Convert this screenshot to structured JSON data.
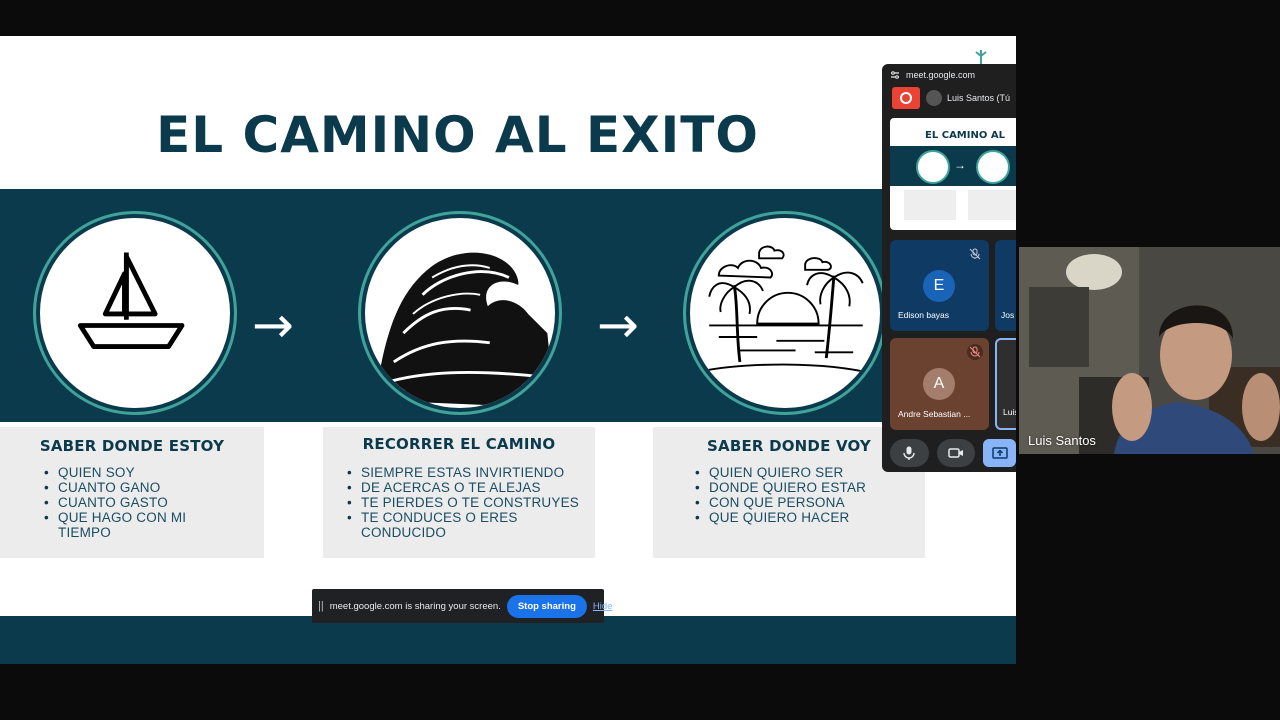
{
  "slide": {
    "title": "EL CAMINO AL EXITO",
    "arrows": [
      "→",
      "→"
    ],
    "cards": [
      {
        "heading": "SABER DONDE ESTOY",
        "items": [
          "QUIEN SOY",
          "CUANTO GANO",
          "CUANTO GASTO",
          "QUE HAGO CON MI TIEMPO"
        ]
      },
      {
        "heading": "RECORRER EL CAMINO",
        "items": [
          "SIEMPRE ESTAS INVIRTIENDO",
          "DE ACERCAS O TE ALEJAS",
          "TE PIERDES O TE CONSTRUYES",
          "TE CONDUCES O ERES CONDUCIDO"
        ]
      },
      {
        "heading": "SABER DONDE VOY",
        "items": [
          "QUIEN QUIERO SER",
          "DONDE QUIERO ESTAR",
          "CON QUE PERSONA",
          "QUE QUIERO HACER"
        ]
      }
    ],
    "icons": [
      "sailboat-icon",
      "wave-icon",
      "beach-island-icon"
    ]
  },
  "share_bar": {
    "pause_icon": "||",
    "message": "meet.google.com is sharing your screen.",
    "stop_label": "Stop sharing",
    "hide_label": "Hide"
  },
  "meet_window": {
    "url": "meet.google.com",
    "presenter": "Luis Santos (Tú",
    "thumb_title": "EL CAMINO AL",
    "participants": [
      {
        "initial": "E",
        "name": "Edison bayas"
      },
      {
        "name": "Jos"
      },
      {
        "initial": "A",
        "name": "Andre Sebastian ..."
      },
      {
        "name": "Luis"
      }
    ]
  },
  "video": {
    "name": "Luis Santos"
  },
  "colors": {
    "navy": "#0b3a4d",
    "teal": "#3fa39a",
    "meet_blue": "#1a73e8"
  }
}
